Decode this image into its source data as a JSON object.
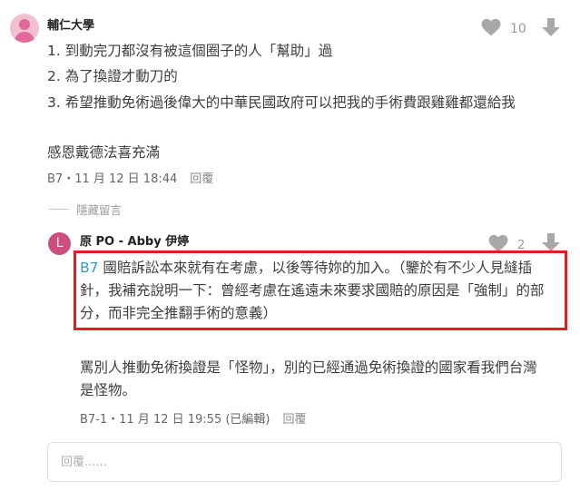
{
  "comment": {
    "author": "輔仁大學",
    "likes": "10",
    "lines": [
      "1. 到動完刀都沒有被這個圈子的人「幫助」過",
      "2. 為了換證才動刀的",
      "3. 希望推動免術過後偉大的中華民國政府可以把我的手術費跟雞雞都還給我",
      "感恩戴德法喜充滿"
    ],
    "meta": "B7・11 月 12 日 18:44",
    "reply_label": "回覆"
  },
  "hidden_label": "隱藏留言",
  "reply": {
    "avatar_letter": "L",
    "author": "原 PO - Abby 伊婷",
    "likes": "2",
    "floor_ref": "B7",
    "highlighted_lines": [
      " 國賠訴訟本來就有在考慮，以後等待妳的加入。（鑒於有不少人見縫插",
      "針，我補充說明一下：曾經考慮在遙遠未來要求國賠的原因是「強制」的部",
      "分，而非完全推翻手術的意義）"
    ],
    "body_lines": [
      "罵別人推動免術換證是「怪物」，別的已經通過免術換證的國家看我們台灣",
      "是怪物。"
    ],
    "meta": "B7-1・11 月 12 日 19:55 (已編輯)",
    "reply_label": "回覆"
  },
  "input": {
    "placeholder": "回覆......"
  },
  "colors": {
    "highlight_border": "#e01e1e",
    "floor_link": "#3a97c9",
    "reply_avatar": "#cc4e7e"
  }
}
